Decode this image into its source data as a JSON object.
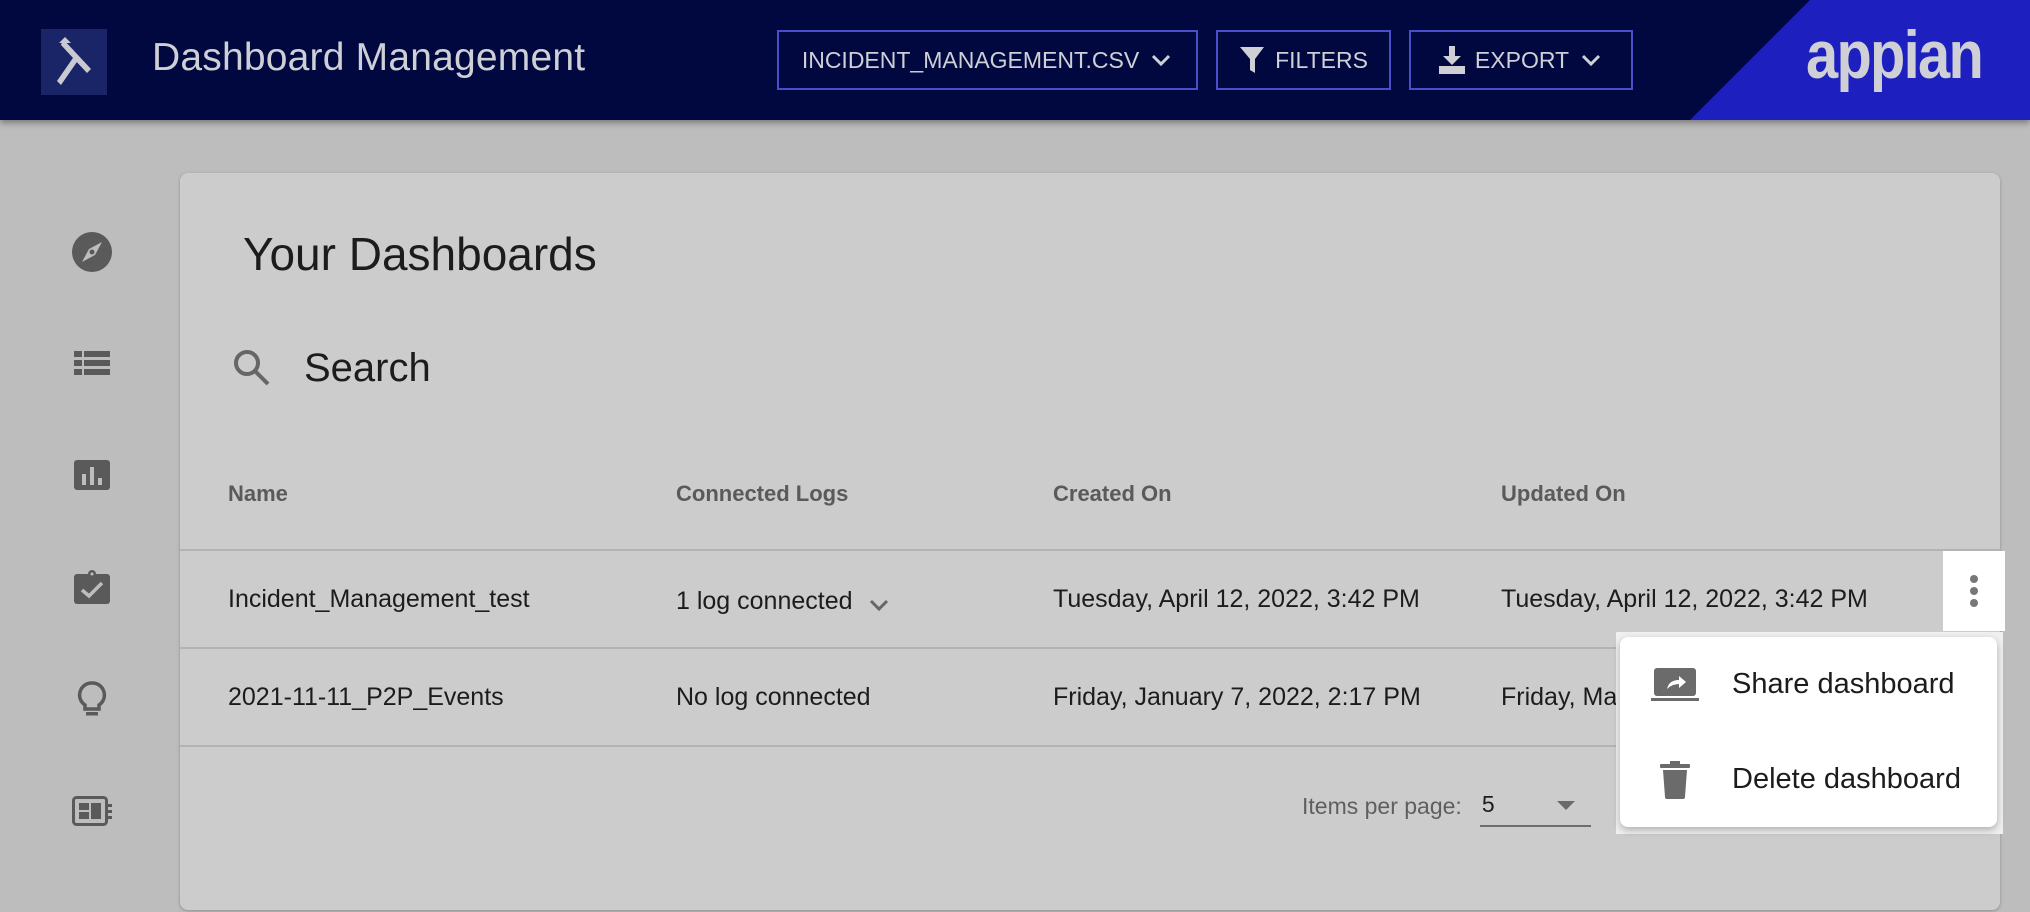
{
  "header": {
    "app_title": "Dashboard Management",
    "brand": "appian",
    "buttons": {
      "file_select": "INCIDENT_MANAGEMENT.CSV",
      "filters": "FILTERS",
      "export": "EXPORT"
    },
    "colors": {
      "bar": "#000840",
      "brand": "#1d1fbf",
      "button_border": "#4a4fc9"
    }
  },
  "sidebar": {
    "items": [
      {
        "icon": "compass-icon",
        "label": "Explore"
      },
      {
        "icon": "list-icon",
        "label": "List"
      },
      {
        "icon": "bar-chart-icon",
        "label": "Charts"
      },
      {
        "icon": "clipboard-check-icon",
        "label": "Tasks"
      },
      {
        "icon": "lightbulb-icon",
        "label": "Insights"
      },
      {
        "icon": "dashboard-icon",
        "label": "Dashboards"
      }
    ]
  },
  "main": {
    "title": "Your Dashboards",
    "search": {
      "placeholder": "Search",
      "value": ""
    },
    "table": {
      "columns": [
        "Name",
        "Connected Logs",
        "Created On",
        "Updated On"
      ],
      "rows": [
        {
          "name": "Incident_Management_test",
          "connected_logs": "1 log connected",
          "created_on": "Tuesday, April 12, 2022, 3:42 PM",
          "updated_on": "Tuesday, April 12, 2022, 3:42 PM"
        },
        {
          "name": "2021-11-11_P2P_Events",
          "connected_logs": "No log connected",
          "created_on": "Friday, January 7, 2022, 2:17 PM",
          "updated_on": "Friday, Ma"
        }
      ]
    },
    "pagination": {
      "label": "Items per page:",
      "value": "5"
    }
  },
  "context_menu": {
    "items": [
      {
        "icon": "share-screen-icon",
        "label": "Share dashboard"
      },
      {
        "icon": "trash-icon",
        "label": "Delete dashboard"
      }
    ]
  }
}
